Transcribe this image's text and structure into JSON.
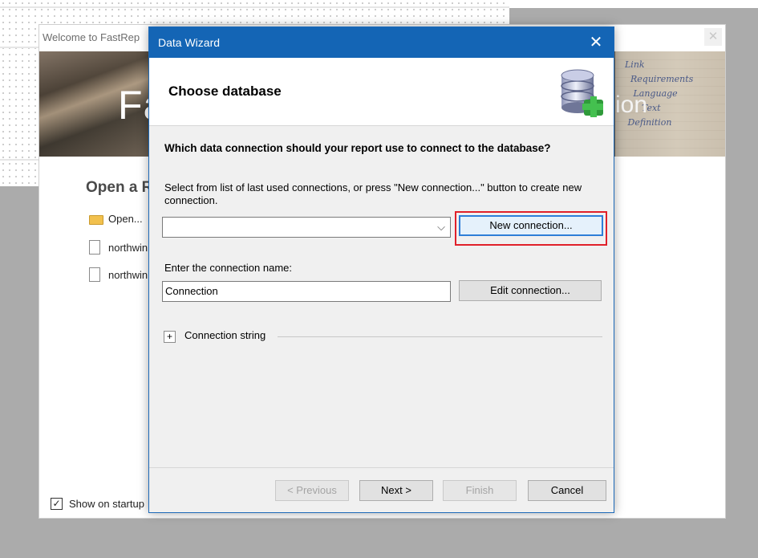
{
  "welcome_window": {
    "title": "Welcome to FastRep",
    "close_label": "✕",
    "banner_text": "Fa",
    "banner_text_right": "ion",
    "banner_paper_text": "Link\nRequirements\nLanguage\nText\nDefinition",
    "heading": "Open a R",
    "recent_items": [
      {
        "label": "Open...",
        "icon": "folder-icon"
      },
      {
        "label": "northwin",
        "icon": "document-icon"
      },
      {
        "label": "northwin",
        "icon": "document-icon"
      }
    ],
    "show_on_startup": {
      "label": "Show on startup",
      "checked": true,
      "check_glyph": "✓"
    }
  },
  "dialog": {
    "title": "Data Wizard",
    "close_glyph": "✕",
    "header_title": "Choose database",
    "header_icon": "database-add-icon",
    "question": "Which data connection should your report use to connect to the database?",
    "hint": "Select from list of last used connections, or press \"New connection...\" button to create new connection.",
    "connection_select": {
      "value": "",
      "arrow": "⌵"
    },
    "new_connection_label": "New connection...",
    "name_label": "Enter the connection name:",
    "name_value": "Connection",
    "edit_connection_label": "Edit connection...",
    "expander_glyph": "+",
    "connection_string_label": "Connection string",
    "buttons": {
      "previous": "< Previous",
      "next": "Next >",
      "finish": "Finish",
      "cancel": "Cancel"
    }
  },
  "colors": {
    "titlebar": "#1465b5",
    "highlight": "#e0202a",
    "focus": "#2e7ed8"
  }
}
